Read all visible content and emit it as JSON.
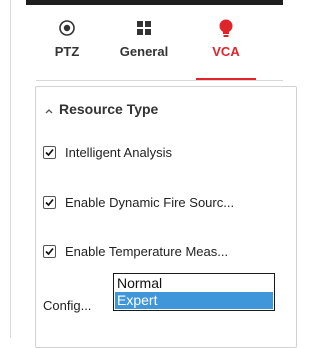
{
  "tabs": [
    {
      "label": "PTZ",
      "icon": "ptz-target-icon",
      "active": false
    },
    {
      "label": "General",
      "icon": "grid-icon",
      "active": false
    },
    {
      "label": "VCA",
      "icon": "bulb-icon",
      "active": true
    }
  ],
  "colors": {
    "accent": "#e0242b",
    "selection": "#3f96d8"
  },
  "resource_section": {
    "title": "Resource Type",
    "expanded": true,
    "options": [
      {
        "label": "Intelligent Analysis",
        "checked": true
      },
      {
        "label": "Enable Dynamic Fire Sourc...",
        "checked": true
      },
      {
        "label": "Enable Temperature Meas...",
        "checked": true
      }
    ],
    "config": {
      "label": "Config...",
      "choices": [
        "Normal",
        "Expert"
      ],
      "highlighted": "Expert"
    }
  }
}
